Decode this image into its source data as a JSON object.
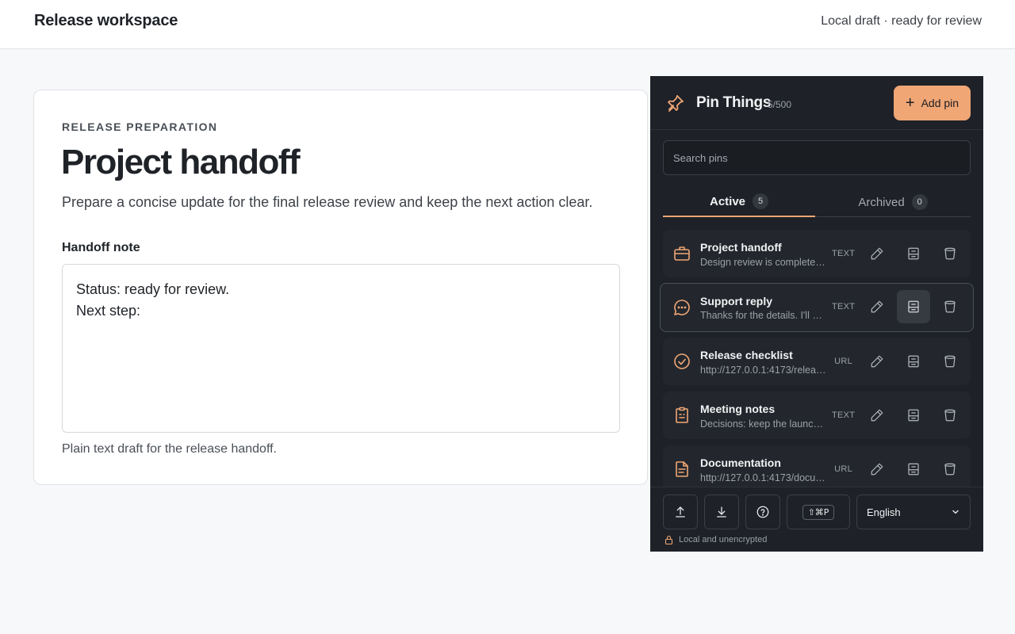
{
  "header": {
    "title": "Release workspace",
    "status": "Local draft · ready for review"
  },
  "card": {
    "eyebrow": "RELEASE PREPARATION",
    "headline": "Project handoff",
    "lede": "Prepare a concise update for the final release review and keep the next action clear.",
    "field_label": "Handoff note",
    "note_value": "Status: ready for review.\nNext step:",
    "hint": "Plain text draft for the release handoff."
  },
  "panel": {
    "title": "Pin Things",
    "count": "5/500",
    "add_label": "Add pin",
    "search_placeholder": "Search pins",
    "tabs": [
      {
        "label": "Active",
        "count": "5"
      },
      {
        "label": "Archived",
        "count": "0"
      }
    ],
    "pins": [
      {
        "name": "Project handoff",
        "desc": "Design review is complete…",
        "type": "TEXT",
        "icon": "briefcase-icon"
      },
      {
        "name": "Support reply",
        "desc": "Thanks for the details. I'll …",
        "type": "TEXT",
        "icon": "chat-icon"
      },
      {
        "name": "Release checklist",
        "desc": "http://127.0.0.1:4173/releas…",
        "type": "URL",
        "icon": "check-circle-icon"
      },
      {
        "name": "Meeting notes",
        "desc": "Decisions: keep the launc…",
        "type": "TEXT",
        "icon": "clipboard-icon"
      },
      {
        "name": "Documentation",
        "desc": "http://127.0.0.1:4173/docu…",
        "type": "URL",
        "icon": "document-icon"
      }
    ],
    "shortcut": "⇧⌘P",
    "language": "English",
    "footer_note": "Local and unencrypted"
  },
  "colors": {
    "accent": "#f0a675",
    "panel_bg": "#1e2127",
    "page_bg": "#f7f8fa"
  }
}
